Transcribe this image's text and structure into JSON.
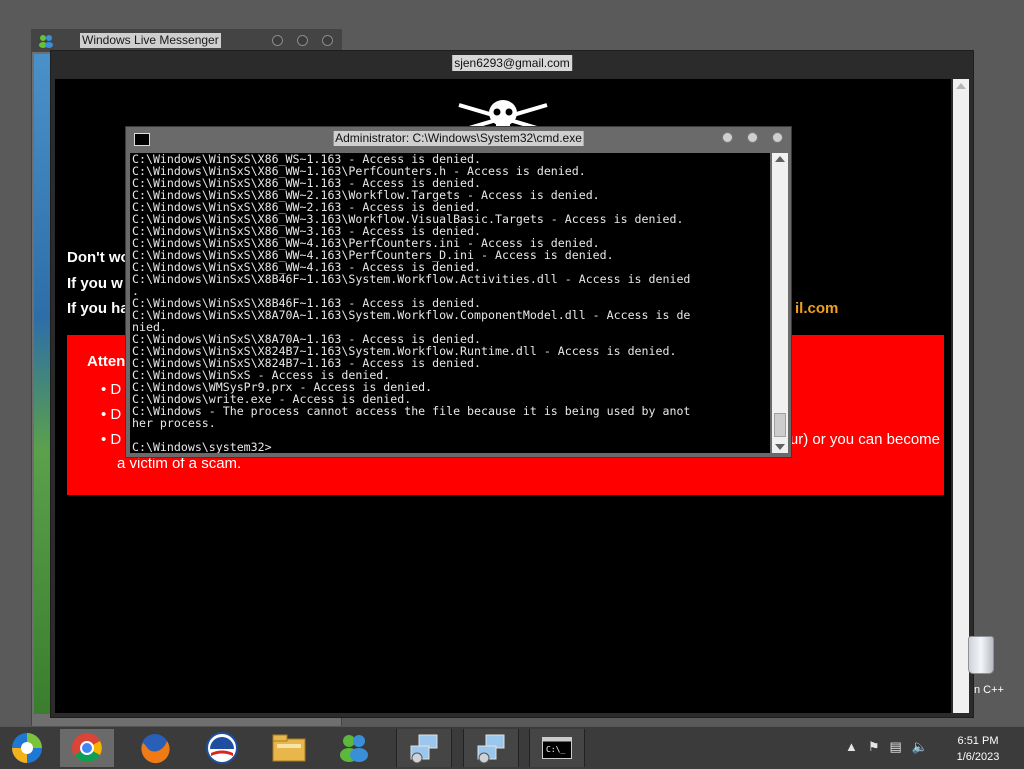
{
  "wlm_window": {
    "title": "Windows Live Messenger",
    "icon": "messenger-icon"
  },
  "browser_window": {
    "title": "sjen6293@gmail.com",
    "lines": [
      "Don't wo",
      "If you w",
      "If you ha"
    ],
    "email_fragment": "il.com",
    "red_box": {
      "heading": "Atten",
      "bullets": [
        "D",
        "D",
        "D"
      ],
      "fragment_right": "ur) or you can become",
      "fragment_victim": "a victim of a scam."
    },
    "colors": {
      "red": "#ff0000",
      "email": "#f0a020"
    }
  },
  "cmd_window": {
    "title": "Administrator: C:\\Windows\\System32\\cmd.exe",
    "lines": [
      "C:\\Windows\\WinSxS\\X86_WS~1.163 - Access is denied.",
      "C:\\Windows\\WinSxS\\X86_WW~1.163\\PerfCounters.h - Access is denied.",
      "C:\\Windows\\WinSxS\\X86_WW~1.163 - Access is denied.",
      "C:\\Windows\\WinSxS\\X86_WW~2.163\\Workflow.Targets - Access is denied.",
      "C:\\Windows\\WinSxS\\X86_WW~2.163 - Access is denied.",
      "C:\\Windows\\WinSxS\\X86_WW~3.163\\Workflow.VisualBasic.Targets - Access is denied.",
      "C:\\Windows\\WinSxS\\X86_WW~3.163 - Access is denied.",
      "C:\\Windows\\WinSxS\\X86_WW~4.163\\PerfCounters.ini - Access is denied.",
      "C:\\Windows\\WinSxS\\X86_WW~4.163\\PerfCounters_D.ini - Access is denied.",
      "C:\\Windows\\WinSxS\\X86_WW~4.163 - Access is denied.",
      "C:\\Windows\\WinSxS\\X8B46F~1.163\\System.Workflow.Activities.dll - Access is denied",
      ".",
      "C:\\Windows\\WinSxS\\X8B46F~1.163 - Access is denied.",
      "C:\\Windows\\WinSxS\\X8A70A~1.163\\System.Workflow.ComponentModel.dll - Access is de",
      "nied.",
      "C:\\Windows\\WinSxS\\X8A70A~1.163 - Access is denied.",
      "C:\\Windows\\WinSxS\\X824B7~1.163\\System.Workflow.Runtime.dll - Access is denied.",
      "C:\\Windows\\WinSxS\\X824B7~1.163 - Access is denied.",
      "C:\\Windows\\WinSxS - Access is denied.",
      "C:\\Windows\\WMSysPr9.prx - Access is denied.",
      "C:\\Windows\\write.exe - Access is denied.",
      "C:\\Windows - The process cannot access the file because it is being used by anot",
      "her process.",
      "",
      "C:\\Windows\\system32>"
    ]
  },
  "desktop": {
    "recycle_label": "n C++"
  },
  "taskbar": {
    "items": [
      {
        "name": "media-center-icon",
        "state": "normal"
      },
      {
        "name": "chrome-icon",
        "state": "active"
      },
      {
        "name": "firefox-icon",
        "state": "normal"
      },
      {
        "name": "obama-logo-icon",
        "state": "normal"
      },
      {
        "name": "file-explorer-icon",
        "state": "normal"
      },
      {
        "name": "messenger-icon",
        "state": "normal"
      },
      {
        "name": "network-setup-icon",
        "state": "running"
      },
      {
        "name": "network-setup-icon",
        "state": "running"
      },
      {
        "name": "command-prompt-icon",
        "state": "running"
      }
    ],
    "tray": {
      "icons": [
        "show-hidden-icons-icon",
        "action-center-flag-icon",
        "network-icon",
        "volume-icon"
      ]
    },
    "clock": {
      "time": "6:51 PM",
      "date": "1/6/2023"
    }
  }
}
